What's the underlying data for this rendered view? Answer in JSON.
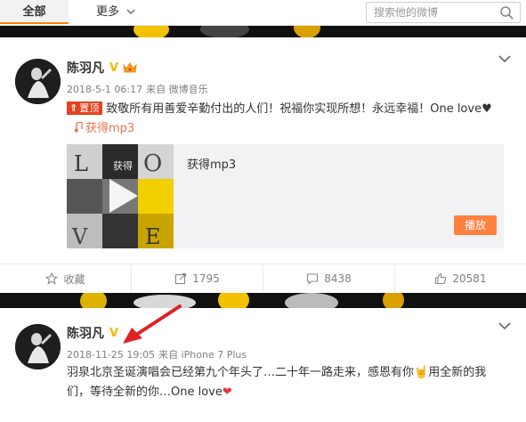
{
  "tabs": {
    "all_label": "全部",
    "more_label": "更多"
  },
  "search": {
    "placeholder": "搜索他的微博"
  },
  "posts": [
    {
      "author": "陈羽凡",
      "verified_mark": "V",
      "meta_time": "2018-5-1 06:17",
      "meta_source": "来自 微博音乐",
      "pinned_label": "置顶",
      "text_part1": "致敬所有用善爱辛勤付出的人们！祝福你实现所想！永远幸福！One love",
      "heart": "♥",
      "music_link_label": "获得mp3",
      "music_title": "获得mp3",
      "cover_letters": [
        "L",
        "O",
        "V",
        "E"
      ],
      "cover_caption": "获得",
      "play_button": "播放",
      "actions": {
        "favorite": "收藏",
        "repost": "1795",
        "comment": "8438",
        "like": "20581"
      }
    },
    {
      "author": "陈羽凡",
      "verified_mark": "V",
      "meta_time": "2018-11-25 19:05",
      "meta_source": "来自 iPhone 7 Plus",
      "text_part1": "羽泉北京圣诞演唱会已经第九个年头了…二十年一路走来，感恩有你",
      "emoji": "🤘",
      "text_part2": "用全新的我们，等待全新的你…One love",
      "heart": "❤"
    }
  ],
  "colors": {
    "accent": "#ff8200",
    "link": "#eb7350",
    "pinned": "#e5421d",
    "play_button": "#ff8140",
    "arrow": "#e02020"
  },
  "icons": [
    "chevron-down-icon",
    "search-icon",
    "close-icon",
    "crown-icon",
    "star-icon",
    "repost-icon",
    "comment-icon",
    "like-icon",
    "play-icon",
    "music-note-icon",
    "red-arrow-annotation"
  ]
}
